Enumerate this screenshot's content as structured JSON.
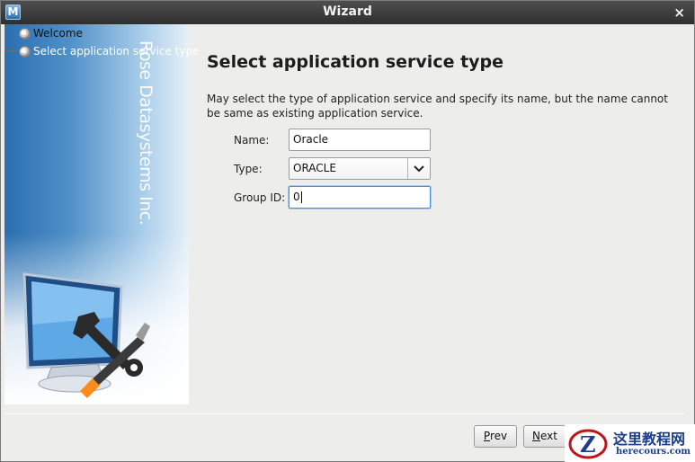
{
  "window": {
    "title": "Wizard",
    "app_icon_letter": "M",
    "close_glyph": "×"
  },
  "side_panel": {
    "vendor_text": "Rose Datasystems Inc.",
    "steps": [
      {
        "label": "Welcome",
        "state": "done"
      },
      {
        "label": "Select application service type",
        "state": "current"
      }
    ]
  },
  "page": {
    "title": "Select application service type",
    "description": "May select the type of application service and specify its name, but the name cannot be same as existing application service."
  },
  "form": {
    "name_label": "Name:",
    "name_value": "Oracle",
    "type_label": "Type:",
    "type_value": "ORACLE",
    "type_arrow": "⌄",
    "group_label": "Group ID:",
    "group_value": "0"
  },
  "buttons": {
    "prev_mnemonic": "P",
    "prev_rest": "rev",
    "next_mnemonic": "N",
    "next_rest": "ext"
  },
  "watermark": {
    "cn": "这里教程网",
    "en": "herecours.com",
    "logo_letter": "Z"
  },
  "colors": {
    "title_bar": "#3a3a3a",
    "panel_blue": "#2b6fb0",
    "background": "#ededec",
    "focus": "#4a90d9",
    "watermark": "#1d3e8a"
  }
}
